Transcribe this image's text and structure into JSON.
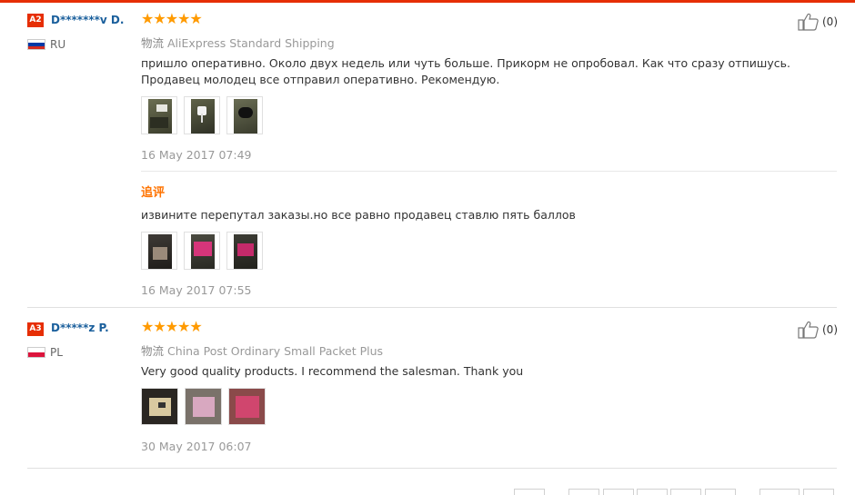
{
  "reviews": [
    {
      "level": "A2",
      "level_color": "#e62e04",
      "user": "D*******v D.",
      "country": "RU",
      "rating_stars": "★★★★★",
      "rating": 5,
      "likes": "(0)",
      "shipping_label": "物流",
      "shipping": "AliExpress Standard Shipping",
      "text": "пришло оперативно. Около двух недель или чуть больше. Прикорм не опробовал. Как что сразу отпишусь. Продавец молодец все отправил оперативно. Рекомендую.",
      "date": "16 May 2017 07:49",
      "followup": {
        "title": "追评",
        "text": "извините перепутал заказы.но все равно продавец ставлю пять баллов",
        "date": "16 May 2017 07:55"
      }
    },
    {
      "level": "A3",
      "level_color": "#e62e04",
      "user": "D*****z P.",
      "country": "PL",
      "rating_stars": "★★★★★",
      "rating": 5,
      "likes": "(0)",
      "shipping_label": "物流",
      "shipping": "China Post Ordinary Small Packet Plus",
      "text": "Very good quality products. I recommend the salesman. Thank you",
      "date": "30 May 2017 06:07"
    }
  ],
  "colors": {
    "accent": "#e62e04",
    "star": "#ff9a00",
    "followup_title": "#ff7300",
    "username": "#1a5f9c"
  },
  "icons": {
    "like": "thumbs-up-icon",
    "flag_ru": "russia-flag-icon",
    "flag_pl": "poland-flag-icon"
  }
}
